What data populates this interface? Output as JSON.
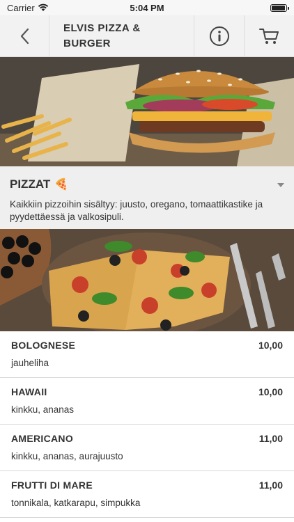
{
  "status": {
    "carrier": "Carrier",
    "time": "5:04 PM"
  },
  "nav": {
    "title_line1": "ELVIS PIZZA &",
    "title_line2": "BURGER"
  },
  "category": {
    "title": "PIZZAT",
    "emoji": "🍕",
    "description": "Kaikkiin pizzoihin sisältyy: juusto, oregano, tomaattikastike ja pyydettäessä ja valkosipuli."
  },
  "items": [
    {
      "name": "BOLOGNESE",
      "price": "10,00",
      "desc": "jauheliha"
    },
    {
      "name": "HAWAII",
      "price": "10,00",
      "desc": "kinkku, ananas"
    },
    {
      "name": "AMERICANO",
      "price": "11,00",
      "desc": "kinkku, ananas, aurajuusto"
    },
    {
      "name": "FRUTTI DI MARE",
      "price": "11,00",
      "desc": "tonnikala, katkarapu, simpukka"
    }
  ],
  "colors": {
    "nav_bg": "#f2f2f2",
    "category_bg": "#efefef",
    "text": "#333333"
  }
}
